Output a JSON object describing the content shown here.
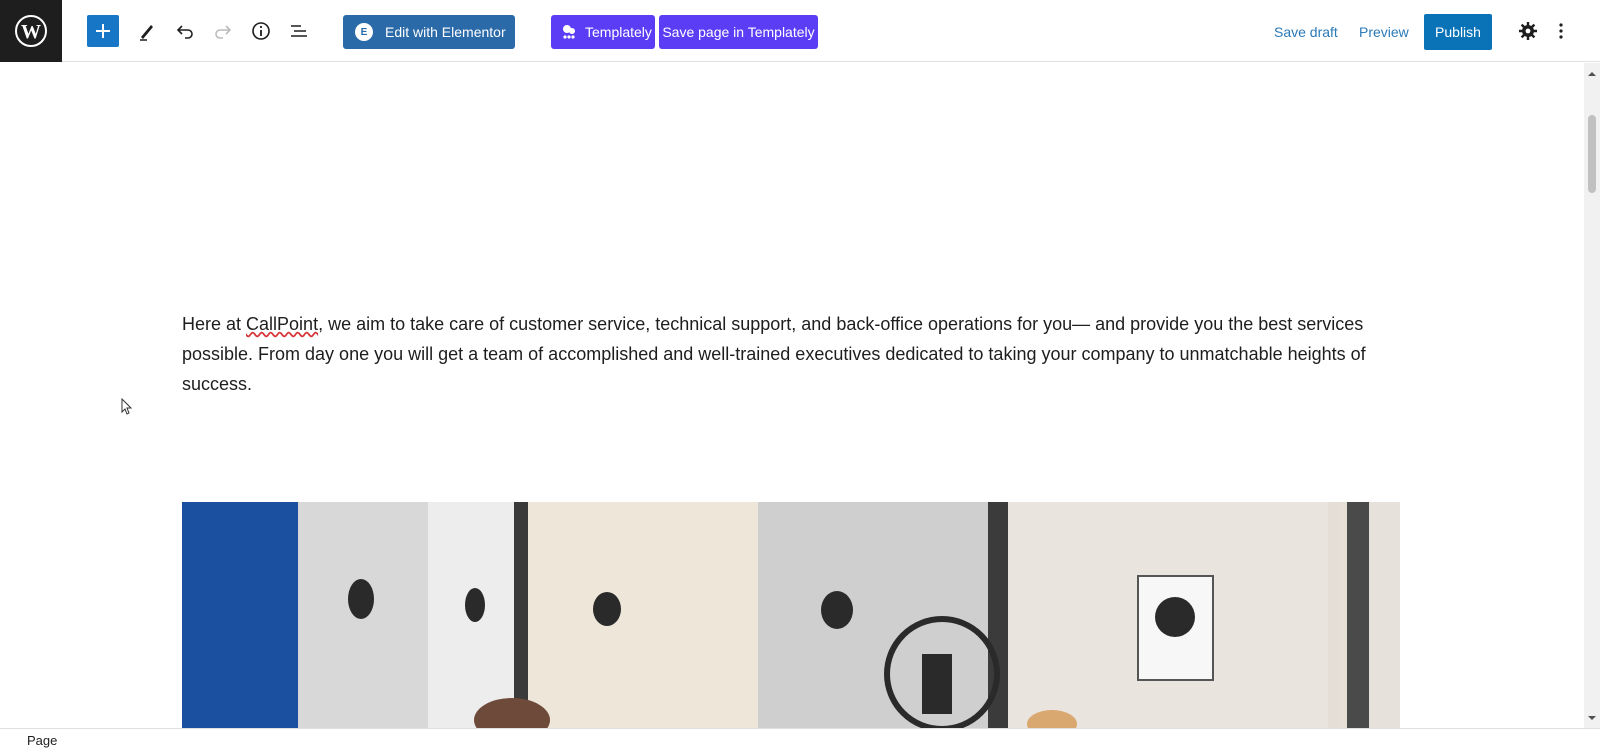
{
  "toolbar": {
    "add_block_icon": "plus-icon",
    "tools_icon": "pencil-icon",
    "undo_icon": "undo-icon",
    "redo_icon": "redo-icon",
    "details_icon": "info-icon",
    "list_view_icon": "list-view-icon",
    "edit_elementor_label": "Edit with Elementor",
    "templately_label": "Templately",
    "save_templately_label": "Save page in Templately",
    "save_draft_label": "Save draft",
    "preview_label": "Preview",
    "publish_label": "Publish",
    "settings_icon": "gear-icon",
    "more_icon": "more-vertical-icon"
  },
  "content": {
    "paragraph_before": "Here at ",
    "paragraph_link": "CallPoint",
    "paragraph_after": ", we aim to take care of customer service, technical support, and back-office operations for you— and provide you the best services possible. From day one you will get a team of accomplished and well-trained executives dedicated to taking your company to unmatchable heights of success."
  },
  "footer": {
    "breadcrumb": "Page"
  },
  "colors": {
    "wp_dark": "#1e1e1e",
    "primary_blue": "#0a73b8",
    "elementor_blue": "#2a6aa8",
    "templately_purple": "#5b3df5",
    "link_blue": "#2a7ab8"
  }
}
